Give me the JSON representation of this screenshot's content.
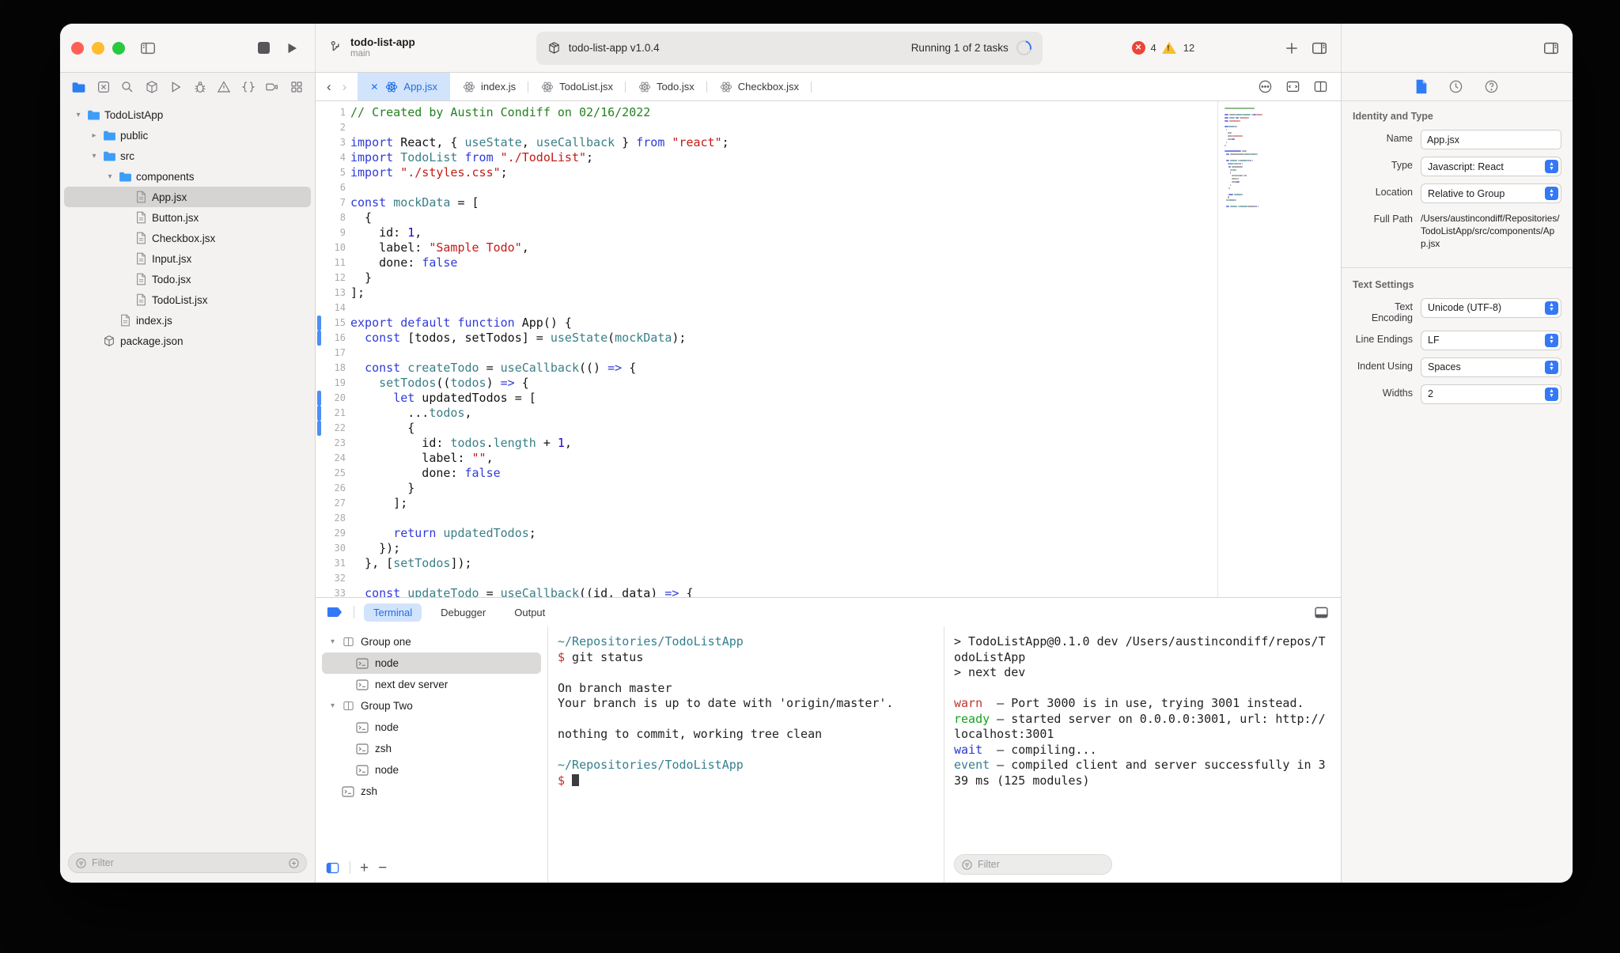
{
  "toolbar": {
    "project": {
      "name": "todo-list-app",
      "branch": "main"
    },
    "status": {
      "package_label": "todo-list-app v1.0.4",
      "running_label": "Running 1 of 2 tasks",
      "error_count": "4",
      "warning_count": "12"
    }
  },
  "navigator": {
    "files": [
      {
        "label": "TodoListApp",
        "type": "folder",
        "depth": 0,
        "expanded": true
      },
      {
        "label": "public",
        "type": "folder",
        "depth": 1,
        "expanded": false
      },
      {
        "label": "src",
        "type": "folder",
        "depth": 1,
        "expanded": true
      },
      {
        "label": "components",
        "type": "folder",
        "depth": 2,
        "expanded": true
      },
      {
        "label": "App.jsx",
        "type": "file",
        "depth": 3,
        "selected": true
      },
      {
        "label": "Button.jsx",
        "type": "file",
        "depth": 3
      },
      {
        "label": "Checkbox.jsx",
        "type": "file",
        "depth": 3
      },
      {
        "label": "Input.jsx",
        "type": "file",
        "depth": 3
      },
      {
        "label": "Todo.jsx",
        "type": "file",
        "depth": 3
      },
      {
        "label": "TodoList.jsx",
        "type": "file",
        "depth": 3
      },
      {
        "label": "index.js",
        "type": "file",
        "depth": 2
      },
      {
        "label": "package.json",
        "type": "package",
        "depth": 1
      }
    ],
    "filter_placeholder": "Filter"
  },
  "tabs": [
    {
      "label": "App.jsx",
      "active": true
    },
    {
      "label": "index.js"
    },
    {
      "label": "TodoList.jsx"
    },
    {
      "label": "Todo.jsx"
    },
    {
      "label": "Checkbox.jsx"
    }
  ],
  "editor": {
    "lines": [
      {
        "n": 1,
        "tokens": [
          [
            "c",
            "// Created by Austin Condiff on 02/16/2022"
          ]
        ]
      },
      {
        "n": 2,
        "tokens": []
      },
      {
        "n": 3,
        "tokens": [
          [
            "k",
            "import"
          ],
          [
            "p",
            " React, { "
          ],
          [
            "t",
            "useState"
          ],
          [
            "p",
            ", "
          ],
          [
            "t",
            "useCallback"
          ],
          [
            "p",
            " } "
          ],
          [
            "k",
            "from"
          ],
          [
            "p",
            " "
          ],
          [
            "s",
            "\"react\""
          ],
          [
            "p",
            ";"
          ]
        ]
      },
      {
        "n": 4,
        "tokens": [
          [
            "k",
            "import"
          ],
          [
            "p",
            " "
          ],
          [
            "t",
            "TodoList"
          ],
          [
            "p",
            " "
          ],
          [
            "k",
            "from"
          ],
          [
            "p",
            " "
          ],
          [
            "s",
            "\"./TodoList\""
          ],
          [
            "p",
            ";"
          ]
        ]
      },
      {
        "n": 5,
        "tokens": [
          [
            "k",
            "import"
          ],
          [
            "p",
            " "
          ],
          [
            "s",
            "\"./styles.css\""
          ],
          [
            "p",
            ";"
          ]
        ]
      },
      {
        "n": 6,
        "tokens": []
      },
      {
        "n": 7,
        "tokens": [
          [
            "k",
            "const"
          ],
          [
            "p",
            " "
          ],
          [
            "t",
            "mockData"
          ],
          [
            "p",
            " = ["
          ]
        ]
      },
      {
        "n": 8,
        "tokens": [
          [
            "p",
            "  {"
          ]
        ]
      },
      {
        "n": 9,
        "tokens": [
          [
            "p",
            "    id: "
          ],
          [
            "n",
            "1"
          ],
          [
            "p",
            ","
          ]
        ]
      },
      {
        "n": 10,
        "tokens": [
          [
            "p",
            "    label: "
          ],
          [
            "s",
            "\"Sample Todo\""
          ],
          [
            "p",
            ","
          ]
        ]
      },
      {
        "n": 11,
        "tokens": [
          [
            "p",
            "    done: "
          ],
          [
            "k",
            "false"
          ]
        ]
      },
      {
        "n": 12,
        "tokens": [
          [
            "p",
            "  }"
          ]
        ]
      },
      {
        "n": 13,
        "tokens": [
          [
            "p",
            "];"
          ]
        ]
      },
      {
        "n": 14,
        "tokens": []
      },
      {
        "n": 15,
        "changed": true,
        "tokens": [
          [
            "k",
            "export default function"
          ],
          [
            "p",
            " App() {"
          ]
        ]
      },
      {
        "n": 16,
        "changed": true,
        "tokens": [
          [
            "p",
            "  "
          ],
          [
            "k",
            "const"
          ],
          [
            "p",
            " [todos, setTodos] = "
          ],
          [
            "t",
            "useState"
          ],
          [
            "p",
            "("
          ],
          [
            "t",
            "mockData"
          ],
          [
            "p",
            ");"
          ]
        ]
      },
      {
        "n": 17,
        "tokens": []
      },
      {
        "n": 18,
        "tokens": [
          [
            "p",
            "  "
          ],
          [
            "k",
            "const"
          ],
          [
            "p",
            " "
          ],
          [
            "t",
            "createTodo"
          ],
          [
            "p",
            " = "
          ],
          [
            "t",
            "useCallback"
          ],
          [
            "p",
            "(() "
          ],
          [
            "k",
            "=>"
          ],
          [
            "p",
            " {"
          ]
        ]
      },
      {
        "n": 19,
        "tokens": [
          [
            "p",
            "    "
          ],
          [
            "t",
            "setTodos"
          ],
          [
            "p",
            "(("
          ],
          [
            "t",
            "todos"
          ],
          [
            "p",
            ") "
          ],
          [
            "k",
            "=>"
          ],
          [
            "p",
            " {"
          ]
        ]
      },
      {
        "n": 20,
        "changed": true,
        "tokens": [
          [
            "p",
            "      "
          ],
          [
            "k",
            "let"
          ],
          [
            "p",
            " updatedTodos = ["
          ]
        ]
      },
      {
        "n": 21,
        "changed": true,
        "tokens": [
          [
            "p",
            "        ..."
          ],
          [
            "t",
            "todos"
          ],
          [
            "p",
            ","
          ]
        ]
      },
      {
        "n": 22,
        "changed": true,
        "tokens": [
          [
            "p",
            "        {"
          ]
        ]
      },
      {
        "n": 23,
        "tokens": [
          [
            "p",
            "          id: "
          ],
          [
            "t",
            "todos"
          ],
          [
            "p",
            "."
          ],
          [
            "t",
            "length"
          ],
          [
            "p",
            " + "
          ],
          [
            "n",
            "1"
          ],
          [
            "p",
            ","
          ]
        ]
      },
      {
        "n": 24,
        "tokens": [
          [
            "p",
            "          label: "
          ],
          [
            "s",
            "\"\""
          ],
          [
            "p",
            ","
          ]
        ]
      },
      {
        "n": 25,
        "tokens": [
          [
            "p",
            "          done: "
          ],
          [
            "k",
            "false"
          ]
        ]
      },
      {
        "n": 26,
        "tokens": [
          [
            "p",
            "        }"
          ]
        ]
      },
      {
        "n": 27,
        "tokens": [
          [
            "p",
            "      ];"
          ]
        ]
      },
      {
        "n": 28,
        "tokens": []
      },
      {
        "n": 29,
        "tokens": [
          [
            "p",
            "      "
          ],
          [
            "k",
            "return"
          ],
          [
            "p",
            " "
          ],
          [
            "t",
            "updatedTodos"
          ],
          [
            "p",
            ";"
          ]
        ]
      },
      {
        "n": 30,
        "tokens": [
          [
            "p",
            "    });"
          ]
        ]
      },
      {
        "n": 31,
        "tokens": [
          [
            "p",
            "  }, ["
          ],
          [
            "t",
            "setTodos"
          ],
          [
            "p",
            "]);"
          ]
        ]
      },
      {
        "n": 32,
        "tokens": []
      },
      {
        "n": 33,
        "tokens": [
          [
            "p",
            "  "
          ],
          [
            "k",
            "const"
          ],
          [
            "p",
            " "
          ],
          [
            "t",
            "updateTodo"
          ],
          [
            "p",
            " = "
          ],
          [
            "t",
            "useCallback"
          ],
          [
            "p",
            "((id, data) "
          ],
          [
            "k",
            "=>"
          ],
          [
            "p",
            " {"
          ]
        ]
      }
    ]
  },
  "inspector": {
    "identity": {
      "title": "Identity and Type",
      "name_label": "Name",
      "name_value": "App.jsx",
      "type_label": "Type",
      "type_value": "Javascript: React",
      "location_label": "Location",
      "location_value": "Relative to Group",
      "fullpath_label": "Full Path",
      "fullpath_value": "/Users/austincondiff/Repositories/TodoListApp/src/components/App.jsx"
    },
    "text_settings": {
      "title": "Text Settings",
      "encoding_label": "Text Encoding",
      "encoding_value": "Unicode (UTF-8)",
      "line_endings_label": "Line Endings",
      "line_endings_value": "LF",
      "indent_label": "Indent Using",
      "indent_value": "Spaces",
      "widths_label": "Widths",
      "widths_value": "2"
    }
  },
  "drawer": {
    "tabs": [
      "Terminal",
      "Debugger",
      "Output"
    ],
    "active_tab": "Terminal",
    "sessions": [
      {
        "kind": "group",
        "label": "Group one",
        "depth": 0
      },
      {
        "kind": "term",
        "label": "node",
        "depth": 1,
        "selected": true
      },
      {
        "kind": "term",
        "label": "next dev server",
        "depth": 1
      },
      {
        "kind": "group",
        "label": "Group Two",
        "depth": 0
      },
      {
        "kind": "term",
        "label": "node",
        "depth": 1
      },
      {
        "kind": "term",
        "label": "zsh",
        "depth": 1
      },
      {
        "kind": "term",
        "label": "node",
        "depth": 1
      },
      {
        "kind": "term",
        "label": "zsh",
        "depth": 0
      }
    ],
    "terminal_main": [
      [
        [
          "path",
          "~/Repositories/TodoListApp"
        ]
      ],
      [
        [
          "prompt",
          "$"
        ],
        [
          "p",
          " git status"
        ]
      ],
      [],
      [
        [
          "p",
          "On branch master"
        ]
      ],
      [
        [
          "p",
          "Your branch is up to date with 'origin/master'."
        ]
      ],
      [],
      [
        [
          "p",
          "nothing to commit, working tree clean"
        ]
      ],
      [],
      [
        [
          "path",
          "~/Repositories/TodoListApp"
        ]
      ],
      [
        [
          "prompt",
          "$"
        ],
        [
          "p",
          " "
        ],
        [
          "cursor",
          ""
        ]
      ]
    ],
    "terminal_dev": [
      [
        [
          "p",
          "> TodoListApp@0.1.0 dev /Users/austincondiff/repos/TodoListApp"
        ]
      ],
      [
        [
          "p",
          "> next dev"
        ]
      ],
      [],
      [
        [
          "warn",
          "warn"
        ],
        [
          "p",
          "  – Port 3000 is in use, trying 3001 instead."
        ]
      ],
      [
        [
          "ready",
          "ready"
        ],
        [
          "p",
          " – started server on 0.0.0.0:3001, url: http://localhost:3001"
        ]
      ],
      [
        [
          "wait",
          "wait"
        ],
        [
          "p",
          "  – compiling..."
        ]
      ],
      [
        [
          "event",
          "event"
        ],
        [
          "p",
          " – compiled client and server successfully in 339 ms (125 modules)"
        ]
      ]
    ],
    "filter_placeholder": "Filter"
  },
  "colors": {
    "accent": "#3478f6",
    "tab_active_bg": "#d2e3fc",
    "error": "#ec4437",
    "warning": "#f7bd2e"
  }
}
